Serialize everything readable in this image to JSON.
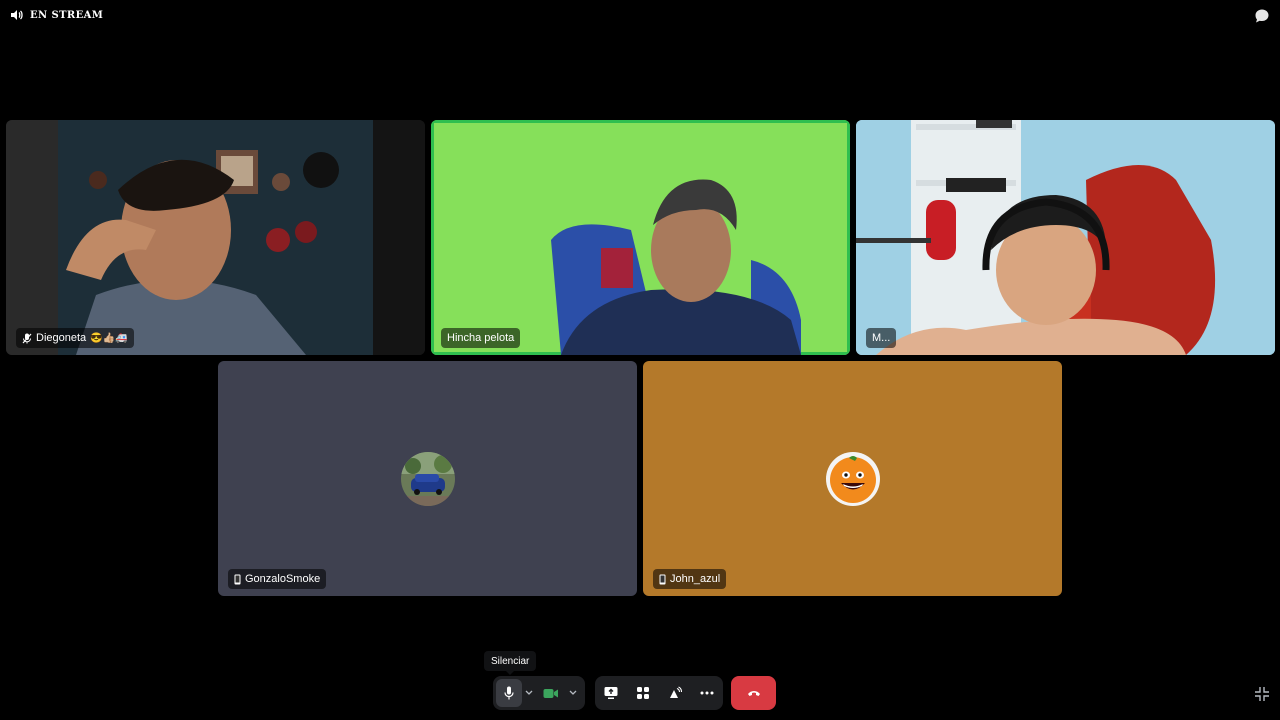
{
  "topbar": {
    "stream_label": "EN STREAM"
  },
  "participants": [
    {
      "name": "Diegoneta",
      "badges": "😎👍🏼🚑"
    },
    {
      "name": "Hincha pelota"
    },
    {
      "name": "M..."
    },
    {
      "name": "GonzaloSmoke"
    },
    {
      "name": "John_azul"
    }
  ],
  "tooltip": {
    "mic": "Silenciar"
  },
  "colors": {
    "speaking_border": "#2fbf4f",
    "end_call": "#d83a42",
    "tile_dark": "#3f4150",
    "tile_orange": "#b4792a"
  },
  "icons": [
    "speaker-icon",
    "chat-bubble-icon",
    "muted-mic-icon",
    "mobile-icon",
    "microphone-icon",
    "chevron-down-icon",
    "camera-icon",
    "screen-share-icon",
    "activities-icon",
    "soundboard-icon",
    "more-icon",
    "hang-up-icon",
    "collapse-icon"
  ]
}
